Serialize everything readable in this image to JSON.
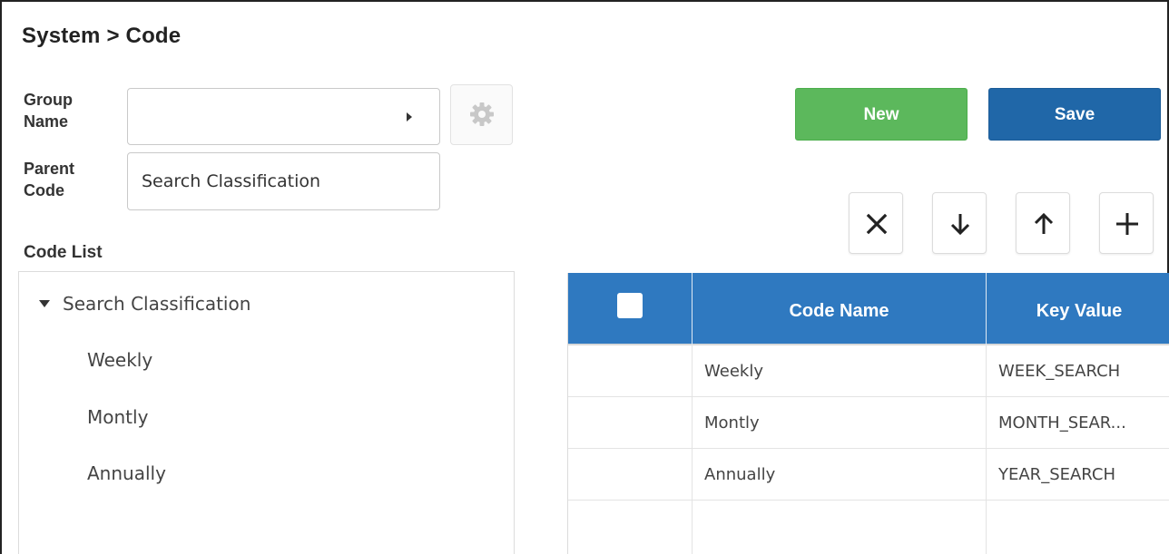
{
  "page": {
    "title": "System > Code"
  },
  "form": {
    "group_name_label": "Group Name",
    "group_name_value": "",
    "parent_code_label": "Parent Code",
    "parent_code_value": "Search Classification",
    "settings_icon": "gear-icon"
  },
  "toolbar": {
    "new_label": "New",
    "save_label": "Save",
    "new_color": "#5cb85c",
    "save_color": "#2067a8",
    "icons": [
      "close-icon",
      "arrow-down-icon",
      "arrow-up-icon",
      "plus-icon"
    ]
  },
  "code_list": {
    "title": "Code List",
    "root": "Search Classification",
    "children": [
      "Weekly",
      "Montly",
      "Annually"
    ]
  },
  "grid": {
    "header_color": "#2f79c0",
    "columns": [
      "",
      "Code Name",
      "Key Value"
    ],
    "rows": [
      {
        "code_name": "Weekly",
        "key_value": "WEEK_SEARCH"
      },
      {
        "code_name": "Montly",
        "key_value": "MONTH_SEAR..."
      },
      {
        "code_name": "Annually",
        "key_value": "YEAR_SEARCH"
      },
      {
        "code_name": "",
        "key_value": ""
      }
    ]
  }
}
